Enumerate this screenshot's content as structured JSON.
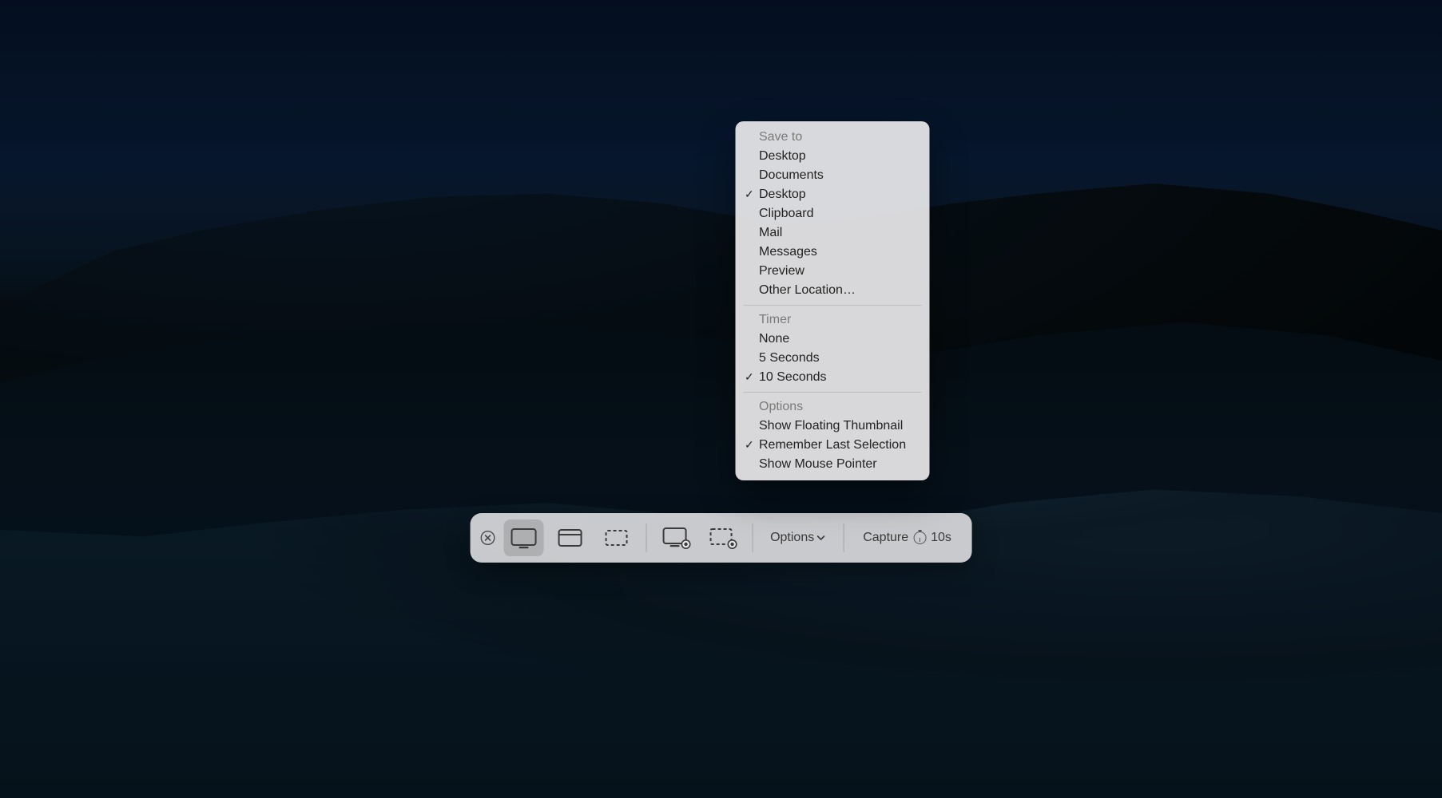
{
  "toolbar": {
    "options_label": "Options",
    "capture_label": "Capture",
    "capture_timer": "10s"
  },
  "menu": {
    "save_to": {
      "header": "Save to",
      "items": [
        {
          "label": "Desktop",
          "checked": false
        },
        {
          "label": "Documents",
          "checked": false
        },
        {
          "label": "Desktop",
          "checked": true
        },
        {
          "label": "Clipboard",
          "checked": false
        },
        {
          "label": "Mail",
          "checked": false
        },
        {
          "label": "Messages",
          "checked": false
        },
        {
          "label": "Preview",
          "checked": false
        },
        {
          "label": "Other Location…",
          "checked": false
        }
      ]
    },
    "timer": {
      "header": "Timer",
      "items": [
        {
          "label": "None",
          "checked": false
        },
        {
          "label": "5 Seconds",
          "checked": false
        },
        {
          "label": "10 Seconds",
          "checked": true
        }
      ]
    },
    "options": {
      "header": "Options",
      "items": [
        {
          "label": "Show Floating Thumbnail",
          "checked": false
        },
        {
          "label": "Remember Last Selection",
          "checked": true
        },
        {
          "label": "Show Mouse Pointer",
          "checked": false
        }
      ]
    }
  }
}
